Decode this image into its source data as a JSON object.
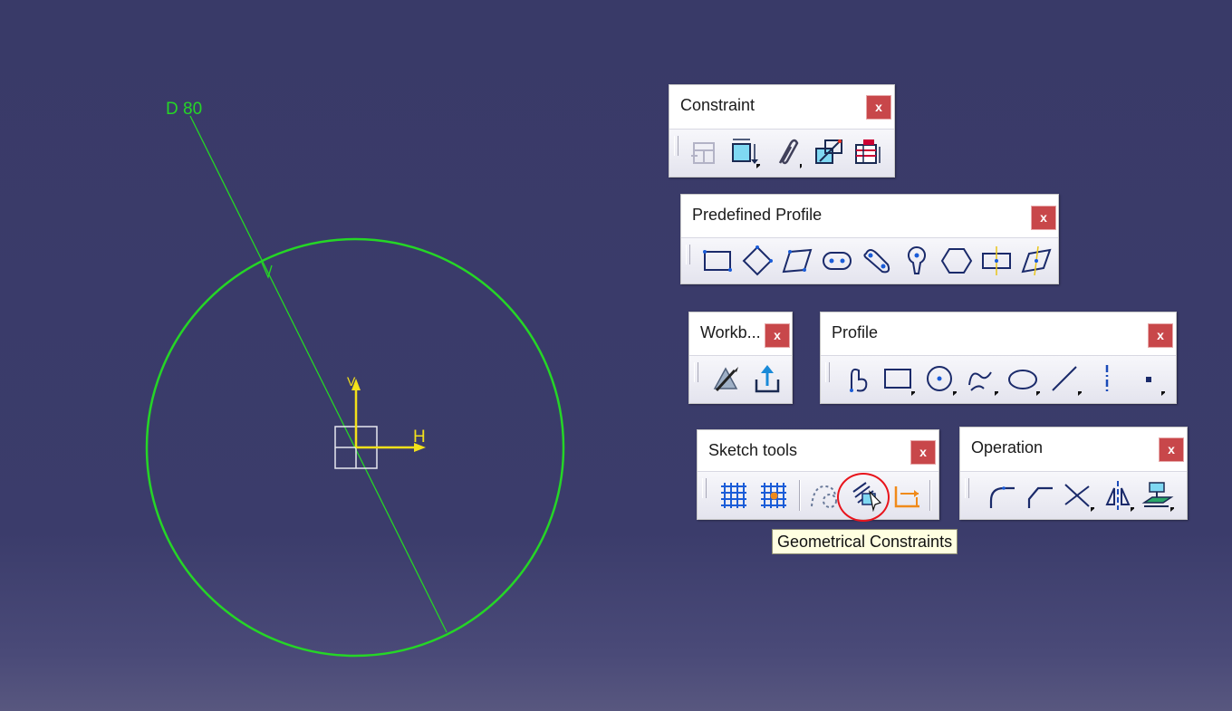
{
  "sketch": {
    "dimension_label": "D 80",
    "axis_h_label": "H",
    "axis_v_label": "V",
    "colors": {
      "geometry": "#25d626",
      "axis": "#f3e11a",
      "origin": "#e8e8f0"
    }
  },
  "toolbars": {
    "constraint": {
      "title": "Constraint",
      "close_label": "x",
      "icons": [
        "constraints-defined-in-dialog-box-icon",
        "constraint-icon",
        "contact-constraint-icon",
        "fix-together-icon",
        "auto-constraint-icon"
      ]
    },
    "predefined_profile": {
      "title": "Predefined Profile",
      "close_label": "x",
      "icons": [
        "rectangle-icon",
        "oriented-rectangle-icon",
        "parallelogram-icon",
        "elongated-hole-icon",
        "cylindrical-elongated-hole-icon",
        "keyhole-profile-icon",
        "hexagon-icon",
        "centered-rectangle-icon",
        "centered-parallelogram-icon"
      ]
    },
    "workbench": {
      "title": "Workb...",
      "close_label": "x",
      "icons": [
        "sketcher-icon",
        "exit-workbench-icon"
      ]
    },
    "profile": {
      "title": "Profile",
      "close_label": "x",
      "icons": [
        "profile-icon",
        "rectangle-icon",
        "circle-icon",
        "spline-icon",
        "ellipse-icon",
        "line-icon",
        "axis-icon",
        "point-icon"
      ]
    },
    "sketch_tools": {
      "title": "Sketch tools",
      "close_label": "x",
      "icons": [
        "grid-icon",
        "snap-to-point-icon",
        "construction-element-icon",
        "geometrical-constraints-icon",
        "dimensional-constraints-icon"
      ]
    },
    "operation": {
      "title": "Operation",
      "close_label": "x",
      "icons": [
        "corner-icon",
        "chamfer-icon",
        "trim-icon",
        "mirror-icon",
        "project-3d-elements-icon"
      ]
    }
  },
  "tooltip": {
    "text": "Geometrical Constraints"
  },
  "highlight": {
    "color": "#e8141c"
  }
}
